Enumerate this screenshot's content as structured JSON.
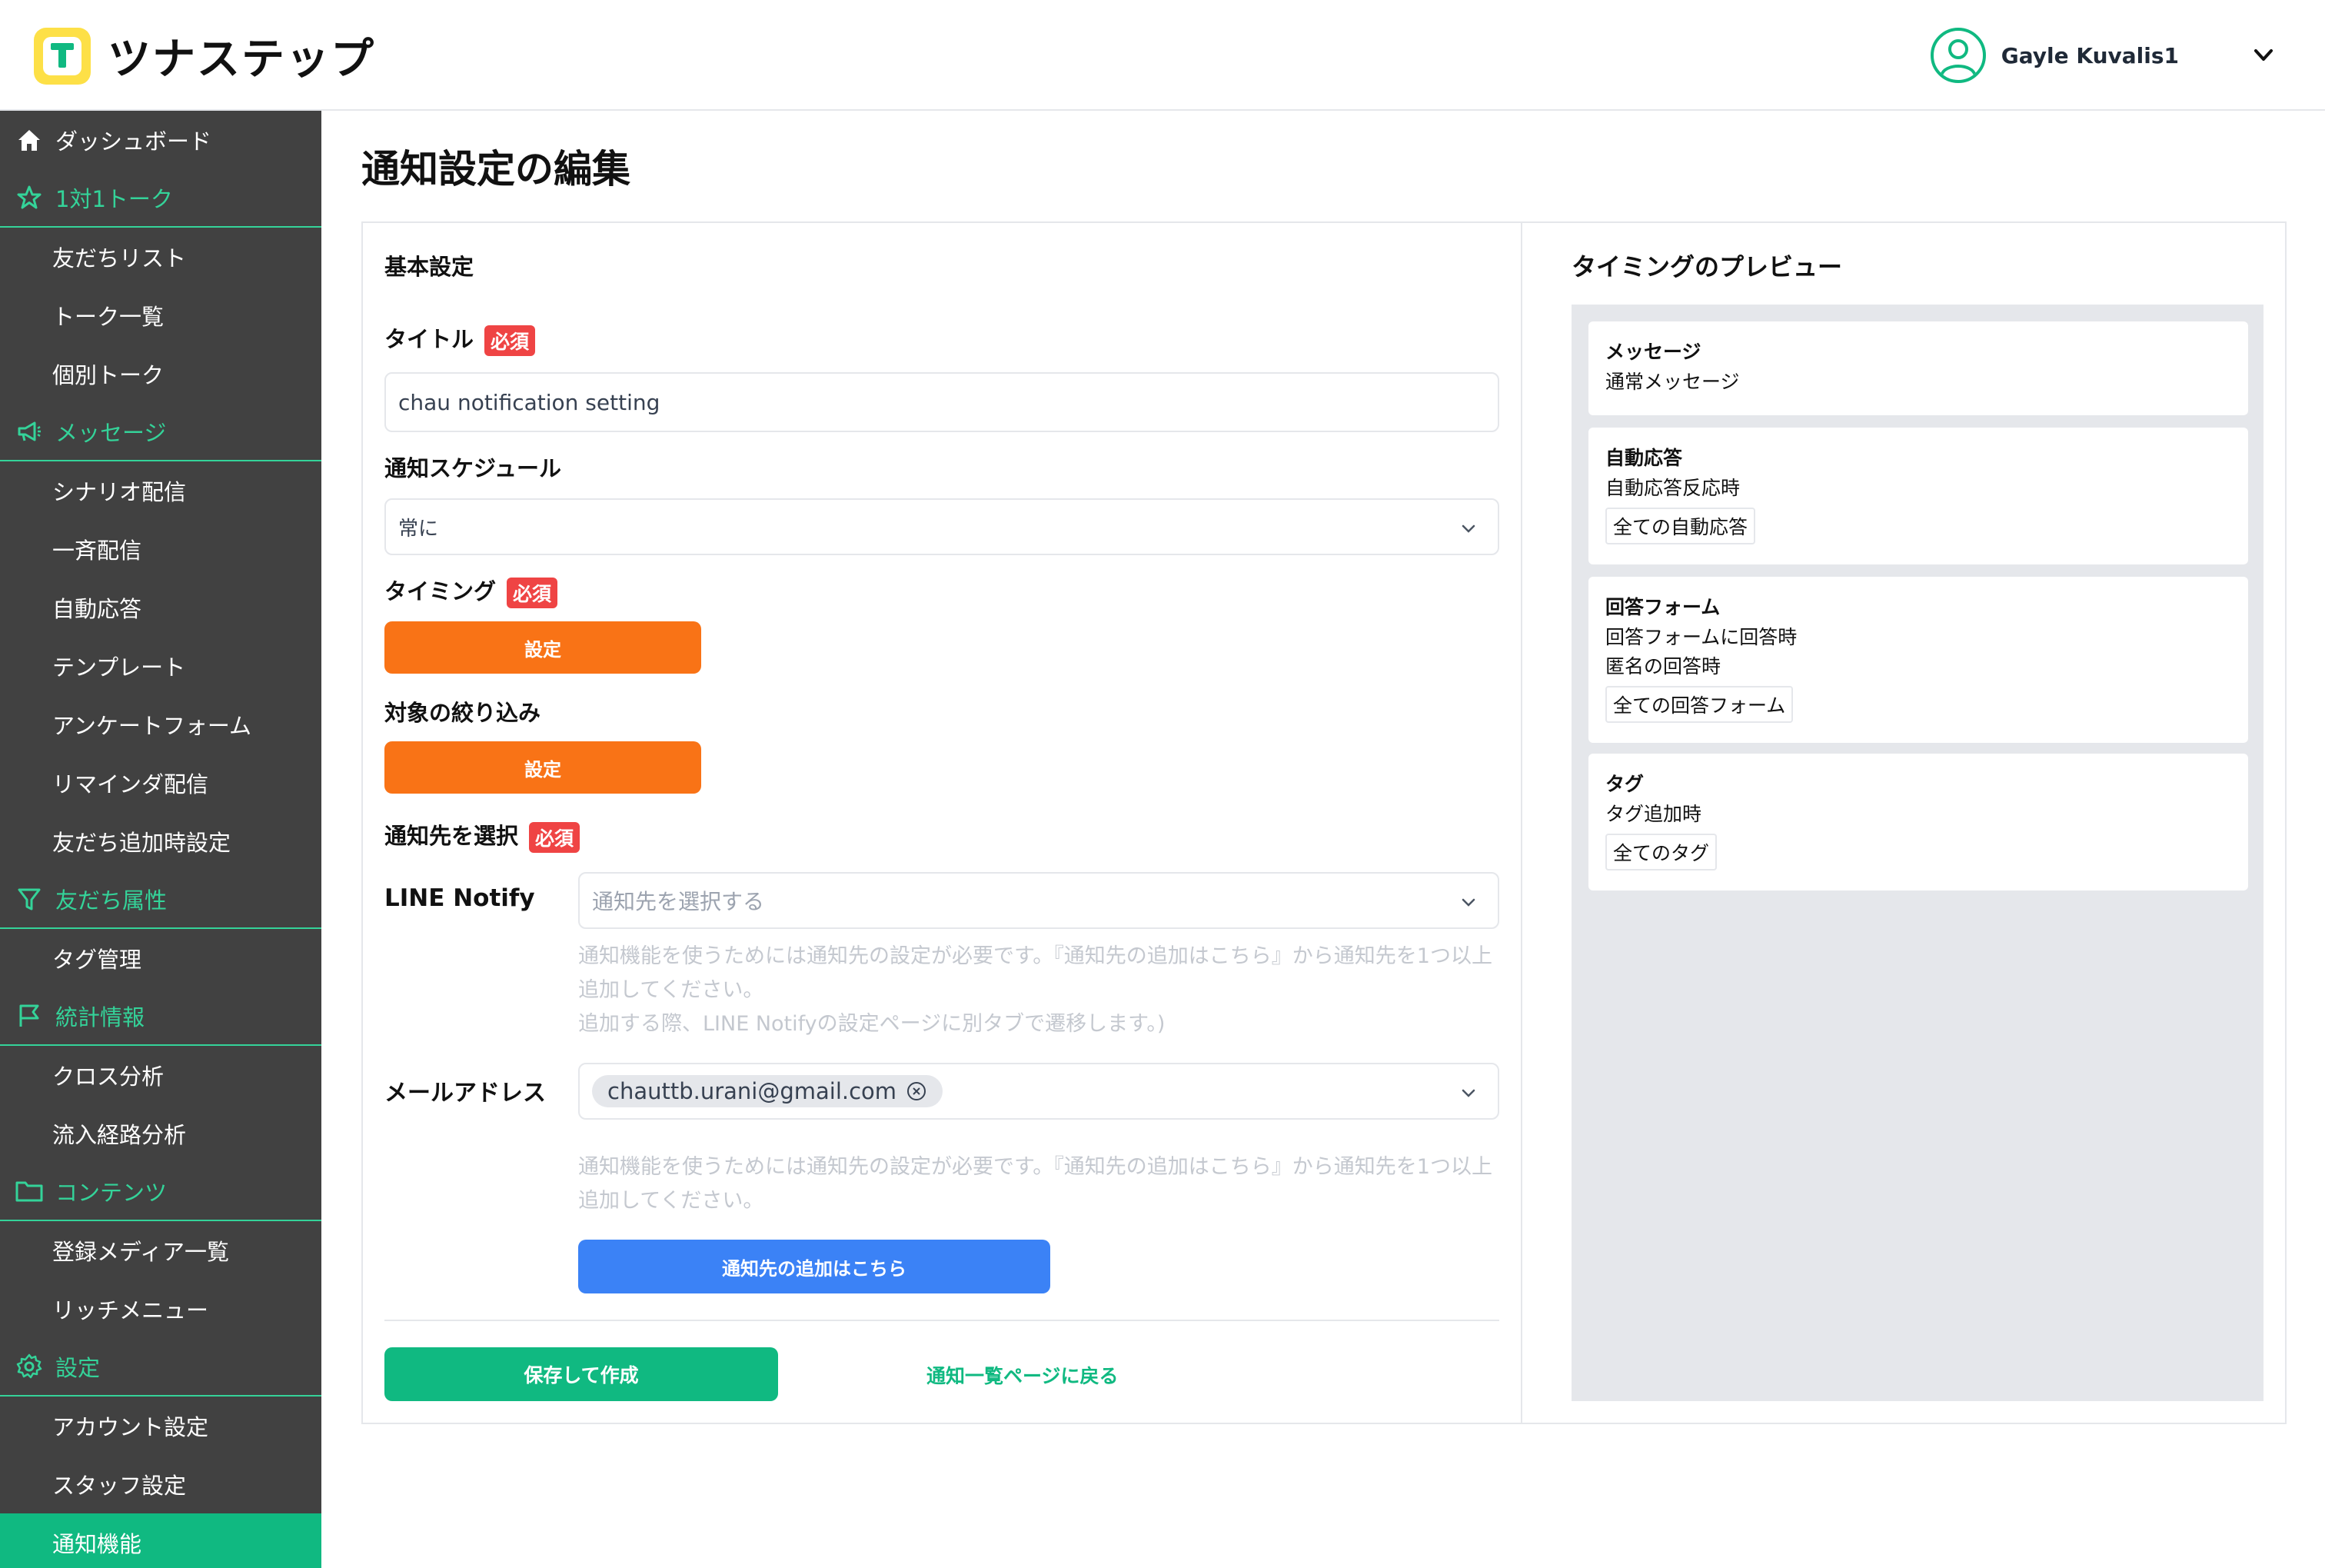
{
  "header": {
    "app_name": "ツナステップ",
    "logo_letter": "T",
    "user_name": "Gayle Kuvalis1"
  },
  "sidebar": {
    "items": [
      {
        "label": "ダッシュボード",
        "type": "section-plain",
        "icon": "home-icon"
      },
      {
        "label": "1対1トーク",
        "type": "section",
        "icon": "star-icon"
      },
      {
        "label": "友だちリスト",
        "type": "sub"
      },
      {
        "label": "トーク一覧",
        "type": "sub"
      },
      {
        "label": "個別トーク",
        "type": "sub"
      },
      {
        "label": "メッセージ",
        "type": "section",
        "icon": "megaphone-icon"
      },
      {
        "label": "シナリオ配信",
        "type": "sub"
      },
      {
        "label": "一斉配信",
        "type": "sub"
      },
      {
        "label": "自動応答",
        "type": "sub"
      },
      {
        "label": "テンプレート",
        "type": "sub"
      },
      {
        "label": "アンケートフォーム",
        "type": "sub"
      },
      {
        "label": "リマインダ配信",
        "type": "sub"
      },
      {
        "label": "友だち追加時設定",
        "type": "sub"
      },
      {
        "label": "友だち属性",
        "type": "section",
        "icon": "filter-icon"
      },
      {
        "label": "タグ管理",
        "type": "sub"
      },
      {
        "label": "統計情報",
        "type": "section",
        "icon": "flag-icon"
      },
      {
        "label": "クロス分析",
        "type": "sub"
      },
      {
        "label": "流入経路分析",
        "type": "sub"
      },
      {
        "label": "コンテンツ",
        "type": "section",
        "icon": "folder-icon"
      },
      {
        "label": "登録メディア一覧",
        "type": "sub"
      },
      {
        "label": "リッチメニュー",
        "type": "sub"
      },
      {
        "label": "設定",
        "type": "section",
        "icon": "gear-icon"
      },
      {
        "label": "アカウント設定",
        "type": "sub"
      },
      {
        "label": "スタッフ設定",
        "type": "sub"
      },
      {
        "label": "通知機能",
        "type": "sub-active"
      }
    ]
  },
  "page": {
    "title": "通知設定の編集"
  },
  "form": {
    "section_title": "基本設定",
    "required_badge": "必須",
    "title_label": "タイトル",
    "title_value": "chau notification setting",
    "schedule_label": "通知スケジュール",
    "schedule_value": "常に",
    "timing_label": "タイミング",
    "timing_button": "設定",
    "filter_label": "対象の絞り込み",
    "filter_button": "設定",
    "destination_label": "通知先を選択",
    "line_notify_label": "LINE Notify",
    "line_notify_placeholder": "通知先を選択する",
    "line_help_1": "通知機能を使うためには通知先の設定が必要です。『通知先の追加はこちら』から通知先を1つ以上追加してください。",
    "line_help_2": "追加する際、LINE Notifyの設定ページに別タブで遷移します。)",
    "email_label": "メールアドレス",
    "email_chip": "chauttb.urani@gmail.com",
    "email_help": "通知機能を使うためには通知先の設定が必要です。『通知先の追加はこちら』から通知先を1つ以上追加してください。",
    "add_destination_button": "通知先の追加はこちら",
    "save_button": "保存して作成",
    "back_link": "通知一覧ページに戻る"
  },
  "preview": {
    "title": "タイミングのプレビュー",
    "cards": [
      {
        "title": "メッセージ",
        "lines": [
          "通常メッセージ"
        ],
        "badge": ""
      },
      {
        "title": "自動応答",
        "lines": [
          "自動応答反応時"
        ],
        "badge": "全ての自動応答"
      },
      {
        "title": "回答フォーム",
        "lines": [
          "回答フォームに回答時",
          "匿名の回答時"
        ],
        "badge": "全ての回答フォーム"
      },
      {
        "title": "タグ",
        "lines": [
          "タグ追加時"
        ],
        "badge": "全てのタグ"
      }
    ]
  },
  "colors": {
    "accent_green": "#10b981",
    "sidebar_bg": "#414141",
    "orange": "#f97316",
    "blue": "#3b82f6",
    "required_red": "#ef4444"
  }
}
